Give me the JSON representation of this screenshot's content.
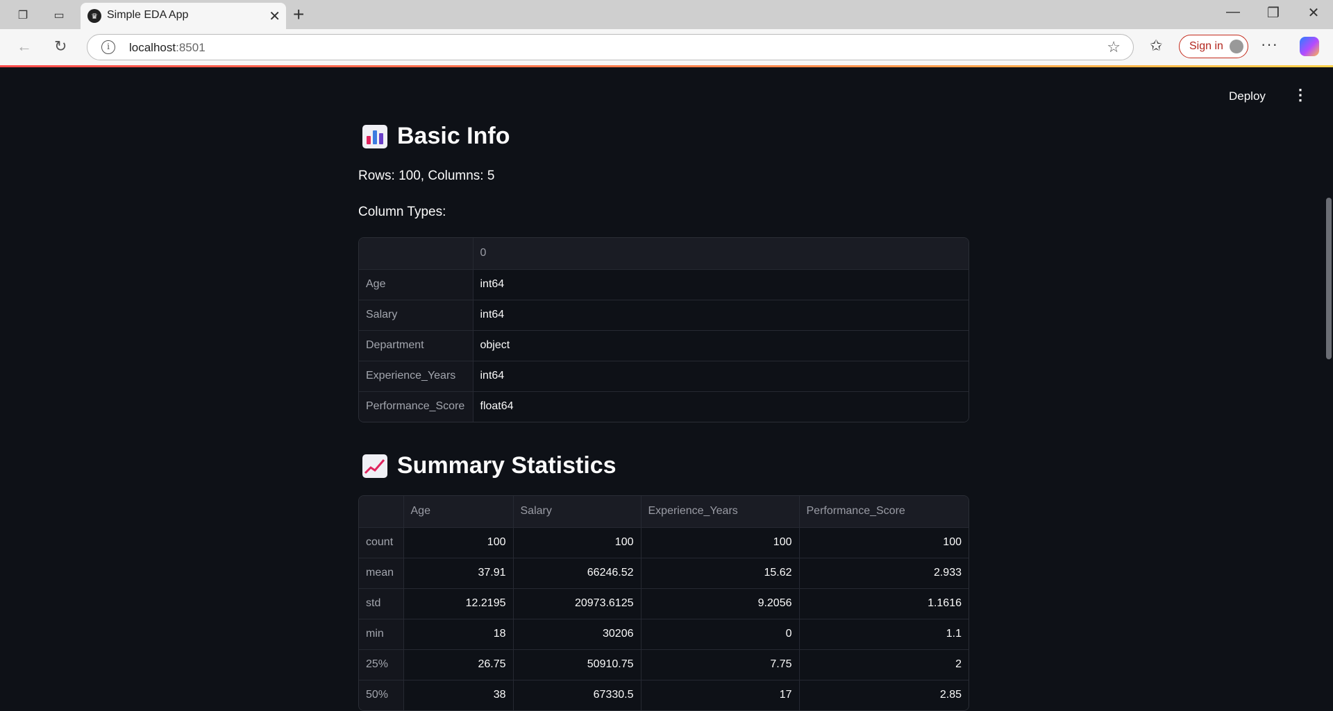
{
  "browser": {
    "tab_title": "Simple EDA App",
    "url_host": "localhost",
    "url_port": ":8501",
    "sign_in_label": "Sign in"
  },
  "app": {
    "deploy_label": "Deploy"
  },
  "basic_info": {
    "title": "Basic Info",
    "rows_cols_text": "Rows: 100, Columns: 5",
    "column_types_label": "Column Types:",
    "table": {
      "header": [
        "",
        "0"
      ],
      "rows": [
        {
          "index": "Age",
          "value": "int64"
        },
        {
          "index": "Salary",
          "value": "int64"
        },
        {
          "index": "Department",
          "value": "object"
        },
        {
          "index": "Experience_Years",
          "value": "int64"
        },
        {
          "index": "Performance_Score",
          "value": "float64"
        }
      ]
    }
  },
  "summary": {
    "title": "Summary Statistics",
    "table": {
      "columns": [
        "",
        "Age",
        "Salary",
        "Experience_Years",
        "Performance_Score"
      ],
      "rows": [
        {
          "index": "count",
          "values": [
            "100",
            "100",
            "100",
            "100"
          ]
        },
        {
          "index": "mean",
          "values": [
            "37.91",
            "66246.52",
            "15.62",
            "2.933"
          ]
        },
        {
          "index": "std",
          "values": [
            "12.2195",
            "20973.6125",
            "9.2056",
            "1.1616"
          ]
        },
        {
          "index": "min",
          "values": [
            "18",
            "30206",
            "0",
            "1.1"
          ]
        },
        {
          "index": "25%",
          "values": [
            "26.75",
            "50910.75",
            "7.75",
            "2"
          ]
        },
        {
          "index": "50%",
          "values": [
            "38",
            "67330.5",
            "17",
            "2.85"
          ]
        }
      ]
    }
  }
}
